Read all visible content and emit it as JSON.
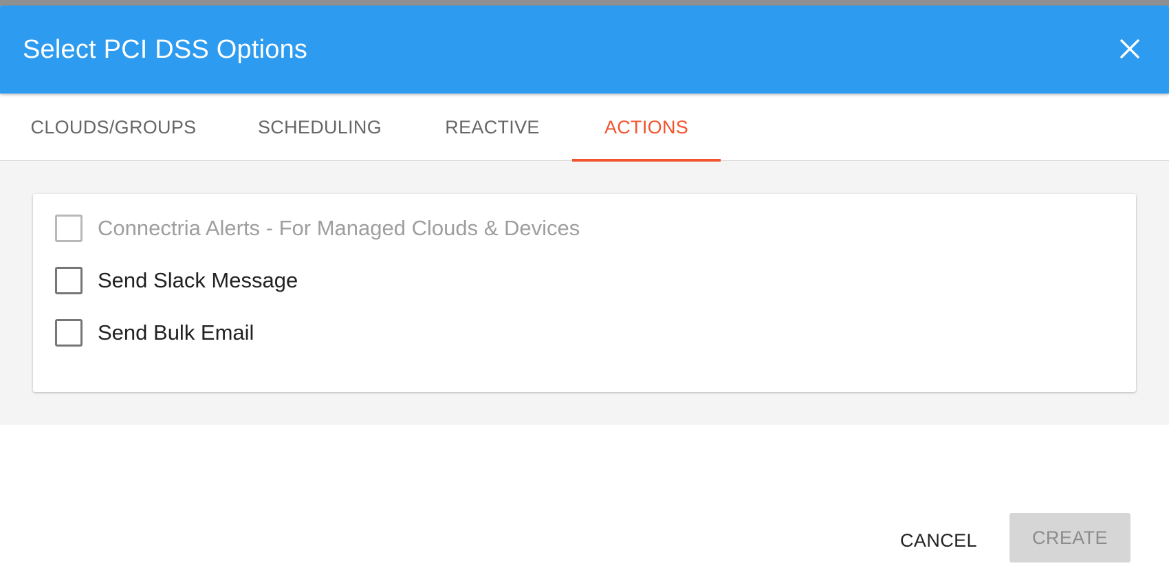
{
  "dialog": {
    "title": "Select PCI DSS Options",
    "close_icon": "close-icon"
  },
  "tabs": [
    {
      "label": "CLOUDS/GROUPS",
      "active": false
    },
    {
      "label": "SCHEDULING",
      "active": false
    },
    {
      "label": "REACTIVE",
      "active": false
    },
    {
      "label": "ACTIONS",
      "active": true
    }
  ],
  "options": [
    {
      "label": "Connectria Alerts - For Managed Clouds & Devices",
      "checked": false,
      "disabled": true
    },
    {
      "label": "Send Slack Message",
      "checked": false,
      "disabled": false
    },
    {
      "label": "Send Bulk Email",
      "checked": false,
      "disabled": false
    }
  ],
  "footer": {
    "cancel_label": "CANCEL",
    "create_label": "CREATE",
    "create_disabled": true
  },
  "colors": {
    "header_bg": "#2d9bf0",
    "active_tab": "#f2532e",
    "content_bg": "#f4f4f4"
  }
}
